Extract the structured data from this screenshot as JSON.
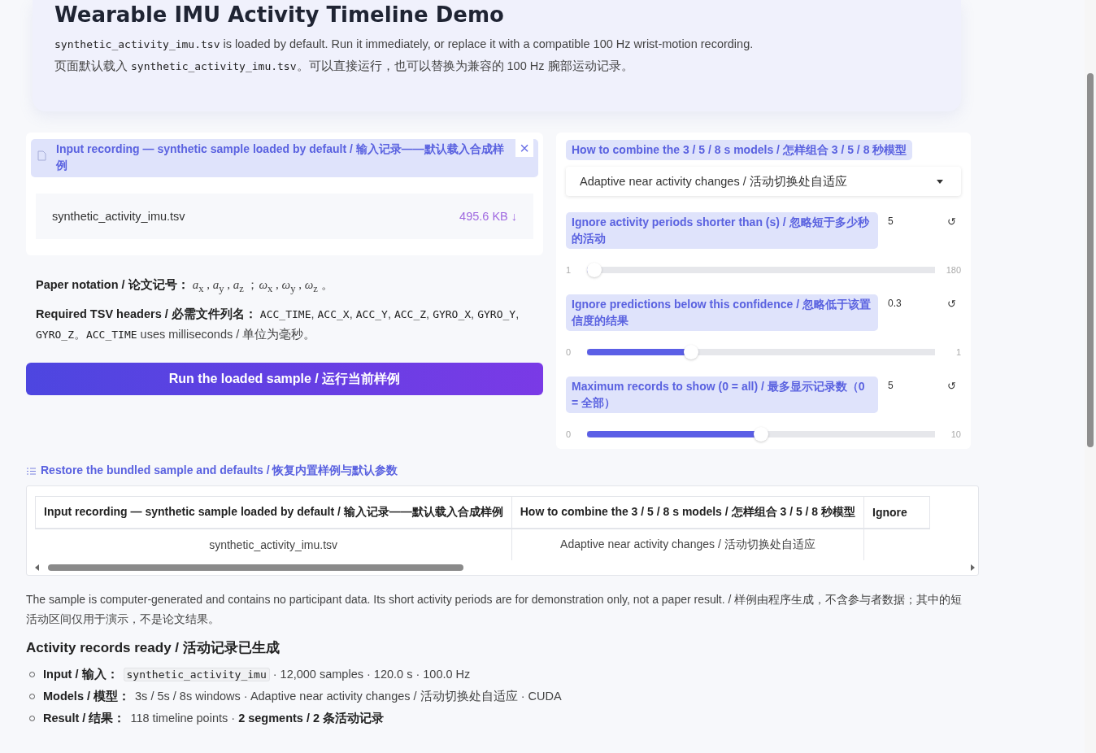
{
  "header": {
    "title": "Wearable IMU Activity Timeline Demo",
    "intro_en": [
      {
        "kind": "code",
        "text": "synthetic_activity_imu.tsv"
      },
      {
        "kind": "text",
        "text": " is loaded by default. Run it immediately, or replace it with a compatible 100 Hz wrist-motion recording."
      }
    ],
    "intro_zh": [
      {
        "kind": "text",
        "text": "页面默认载入 "
      },
      {
        "kind": "code",
        "text": "synthetic_activity_imu.tsv"
      },
      {
        "kind": "text",
        "text": "。可以直接运行，也可以替换为兼容的 100 Hz 腕部运动记录。"
      }
    ]
  },
  "upload": {
    "label": "Input recording — synthetic sample loaded by default / 输入记录——默认载入合成样例",
    "file_name": "synthetic_activity_imu.tsv",
    "file_size": "495.6 KB ↓",
    "close": "×"
  },
  "notation": {
    "label": "Paper notation / 论文记号：",
    "value": "*a*$_{x}$ , *a*$_{y}$ , *a*$_{z}$ ；*ω*$_{x}$ , *ω*$_{y}$ , *ω*$_{z}$ 。"
  },
  "headers": {
    "label": "Required TSV headers / 必需文件列名：",
    "value": [
      {
        "kind": "code",
        "text": "ACC_TIME"
      },
      {
        "kind": "text",
        "text": ", "
      },
      {
        "kind": "code",
        "text": "ACC_X"
      },
      {
        "kind": "text",
        "text": ", "
      },
      {
        "kind": "code",
        "text": "ACC_Y"
      },
      {
        "kind": "text",
        "text": ", "
      },
      {
        "kind": "code",
        "text": "ACC_Z"
      },
      {
        "kind": "text",
        "text": ", "
      },
      {
        "kind": "code",
        "text": "GYRO_X"
      },
      {
        "kind": "text",
        "text": ", "
      },
      {
        "kind": "code",
        "text": "GYRO_Y"
      },
      {
        "kind": "text",
        "text": ", "
      },
      {
        "kind": "code",
        "text": "GYRO_Z"
      },
      {
        "kind": "text",
        "text": "。"
      },
      {
        "kind": "code",
        "text": "ACC_TIME"
      },
      {
        "kind": "text",
        "text": " uses milliseconds / 单位为毫秒。"
      }
    ]
  },
  "run_button": "Run the loaded sample / 运行当前样例",
  "settings": {
    "combine_label": "How to combine the 3 / 5 / 8 s models / 怎样组合 3 / 5 / 8 秒模型",
    "combine_value": "Adaptive near activity changes / 活动切换处自适应",
    "sliders": [
      {
        "label": "Ignore activity periods shorter than (s) / 忽略短于多少秒的活动",
        "value": "5",
        "reset": "↺",
        "min": "1",
        "max": "180",
        "level": 0.022
      },
      {
        "label": "Ignore predictions below this confidence / 忽略低于该置信度的结果",
        "value": "0.3",
        "reset": "↺",
        "min": "0",
        "max": "1",
        "level": 0.3
      },
      {
        "label": "Maximum records to show (0 = all) / 最多显示记录数（0 = 全部）",
        "value": "5",
        "reset": "↺",
        "min": "0",
        "max": "10",
        "level": 0.5
      }
    ]
  },
  "restore_link": "Restore the bundled sample and defaults / 恢复内置样例与默认参数",
  "table": {
    "columns": [
      "Input recording — synthetic sample loaded by default / 输入记录——默认载入合成样例",
      "How to combine the 3 / 5 / 8 s models / 怎样组合 3 / 5 / 8 秒模型",
      "Ignore"
    ],
    "rows": [
      [
        "synthetic_activity_imu.tsv",
        "Adaptive near activity changes / 活动切换处自适应"
      ]
    ]
  },
  "note": "The sample is computer-generated and contains no participant data. Its short activity periods are for demonstration only, not a paper result. / 样例由程序生成，不含参与者数据；其中的短活动区间仅用于演示，不是论文结果。",
  "results": {
    "title": "Activity records ready / 活动记录已生成",
    "items": [
      {
        "label": "Input / 输入：",
        "value": [
          {
            "kind": "code",
            "text": "synthetic_activity_imu"
          },
          {
            "kind": "text",
            "text": " · 12,000 samples · 120.0 s · 100.0 Hz"
          }
        ]
      },
      {
        "label": "Models / 模型：",
        "value": [
          {
            "kind": "text",
            "text": "3s / 5s / 8s windows · Adaptive near activity changes / 活动切换处自适应 · CUDA"
          }
        ]
      },
      {
        "label": "Result / 结果：",
        "value": [
          {
            "kind": "text",
            "text": "118 timeline points · "
          },
          {
            "kind": "bold",
            "text": "2 segments / 2 条活动记录"
          }
        ]
      }
    ]
  }
}
